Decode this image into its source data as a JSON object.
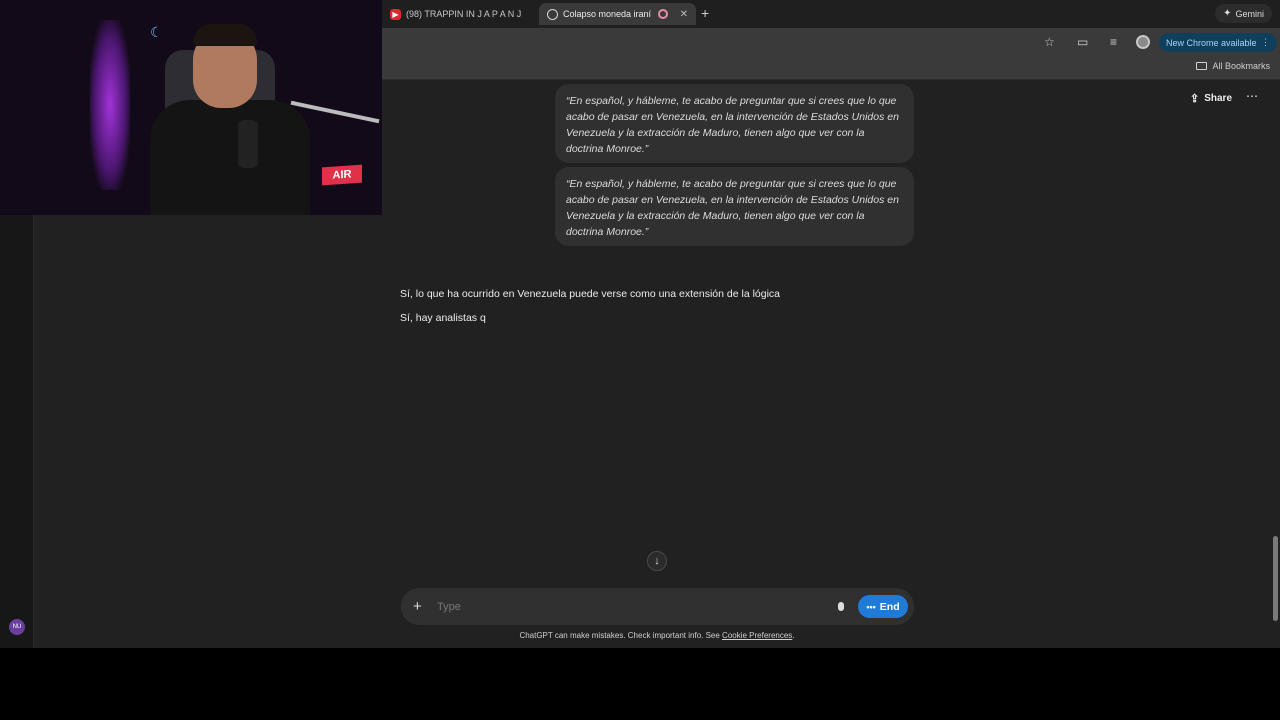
{
  "browser": {
    "tabs": [
      {
        "title": "(98) TRAPPIN IN  J A P A N  J",
        "icon": "youtube-icon",
        "active": false
      },
      {
        "title": "Colapso moneda iraní",
        "icon": "chatgpt-icon",
        "active": true
      }
    ],
    "gemini_label": "Gemini",
    "update_label": "New Chrome available",
    "bookmarks_label": "All Bookmarks"
  },
  "page": {
    "share_label": "Share",
    "user_messages": [
      "“En español, y hábleme, te acabo de preguntar que si crees que lo que acabo de pasar en Venezuela, en la intervención de Estados Unidos en Venezuela y la extracción de Maduro, tienen algo que ver con la doctrina Monroe.”",
      "“En español, y hábleme, te acabo de preguntar que si crees que lo que acabo de pasar en Venezuela, en la intervención de Estados Unidos en Venezuela y la extracción de Maduro, tienen algo que ver con la doctrina Monroe.”"
    ],
    "assistant_lines": [
      "Sí, lo que ha ocurrido en Venezuela puede verse como una extensión de la lógica",
      "Sí, hay analistas q"
    ],
    "composer": {
      "placeholder": "Type",
      "end_label": "End"
    },
    "disclaimer_text": "ChatGPT can make mistakes. Check important info. See ",
    "disclaimer_link": "Cookie Preferences",
    "disclaimer_end": ".",
    "avatar_initials": "NU"
  },
  "webcam": {
    "sign_text": "AIR"
  },
  "colors": {
    "accent": "#1f7ad8",
    "background": "#212121",
    "bubble": "#303030"
  }
}
